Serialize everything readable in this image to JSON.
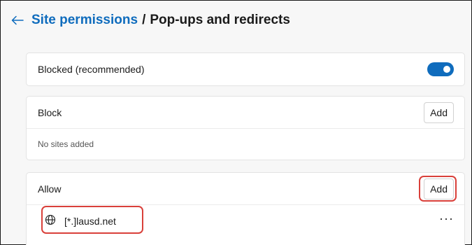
{
  "breadcrumb": {
    "parent": "Site permissions",
    "separator": "/",
    "current": "Pop-ups and redirects"
  },
  "blocked_setting": {
    "label": "Blocked (recommended)",
    "toggle_on": true
  },
  "block_section": {
    "title": "Block",
    "add_label": "Add",
    "empty_text": "No sites added"
  },
  "allow_section": {
    "title": "Allow",
    "add_label": "Add",
    "sites": [
      {
        "name": "[*.]lausd.net",
        "icon": "globe-icon",
        "menu": "···"
      }
    ]
  },
  "colors": {
    "accent": "#0f6cbd",
    "highlight": "#d9403a"
  },
  "icons": {
    "back": "arrow-left-icon",
    "site": "globe-icon",
    "more": "more-options-icon"
  }
}
